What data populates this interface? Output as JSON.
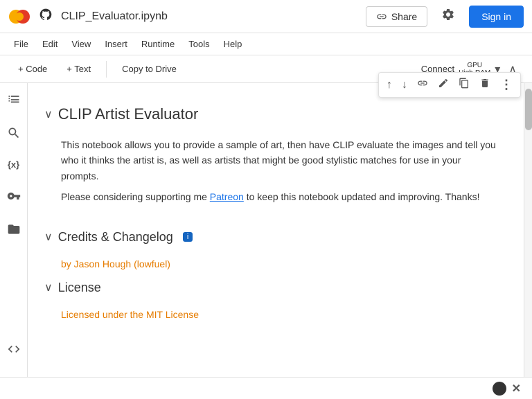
{
  "topbar": {
    "filename": "CLIP_Evaluator.ipynb",
    "share_label": "Share",
    "signin_label": "Sign in"
  },
  "menubar": {
    "items": [
      "File",
      "Edit",
      "View",
      "Insert",
      "Runtime",
      "Tools",
      "Help"
    ]
  },
  "toolbar": {
    "code_btn": "+ Code",
    "text_btn": "+ Text",
    "copy_drive_btn": "Copy to Drive",
    "connect_label": "Connect",
    "gpu_line1": "GPU",
    "gpu_line2": "High-RAM"
  },
  "cell_toolbar": {
    "up_icon": "↑",
    "down_icon": "↓",
    "link_icon": "🔗",
    "edit_icon": "✏",
    "copy_icon": "⧉",
    "delete_icon": "🗑",
    "more_icon": "⋮"
  },
  "sections": {
    "main_title": "CLIP Artist Evaluator",
    "main_description_1": "This notebook allows you to provide a sample of art, then have CLIP evaluate the images and tell you who it thinks the artist is, as well as artists that might be good stylistic matches for use in your prompts.",
    "main_description_2_prefix": "Please considering supporting me ",
    "main_link_text": "Patreon",
    "main_description_2_suffix": " to keep this notebook updated and improving. Thanks!",
    "credits_title": "Credits & Changelog",
    "credits_badge": "i",
    "author_text": "by Jason Hough (lowfuel)",
    "license_title": "License",
    "license_text": "Licensed under the MIT License"
  },
  "bottom": {
    "dot_icon": "●",
    "close_icon": "✕"
  }
}
